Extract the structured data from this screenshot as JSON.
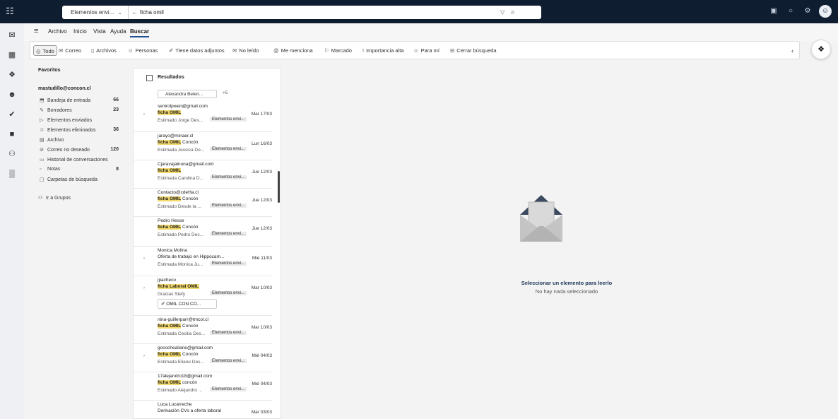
{
  "search": {
    "scope_label": "Elementos envi...",
    "query": "ficha omil"
  },
  "menu": [
    "Archivo",
    "Inicio",
    "Vista",
    "Ayuda",
    "Buscar"
  ],
  "filters": [
    {
      "label": "Todo",
      "icon": "everything-icon"
    },
    {
      "label": "Correo",
      "icon": "mail-icon"
    },
    {
      "label": "Archivos",
      "icon": "file-icon"
    },
    {
      "label": "Personas",
      "icon": "people-icon"
    },
    {
      "label": "Tiene datos adjuntos",
      "icon": "paperclip-icon"
    },
    {
      "label": "No leído",
      "icon": "unread-icon"
    },
    {
      "label": "Me menciona",
      "icon": "at-icon"
    },
    {
      "label": "Marcado",
      "icon": "flag-icon"
    },
    {
      "label": "Importancia alta",
      "icon": "exclamation-icon"
    },
    {
      "label": "Para mí",
      "icon": "person-icon"
    },
    {
      "label": "Cerrar búsqueda",
      "icon": "close-box-icon"
    }
  ],
  "folders": {
    "favorites_label": "Favoritos",
    "account": "mastudillo@concon.cl",
    "items": [
      {
        "label": "Bandeja de entrada",
        "count": "66",
        "icon": "inbox-icon"
      },
      {
        "label": "Borradores",
        "count": "23",
        "icon": "pencil-icon"
      },
      {
        "label": "Elementos enviados",
        "count": "",
        "icon": "send-icon"
      },
      {
        "label": "Elementos eliminados",
        "count": "36",
        "icon": "trash-icon"
      },
      {
        "label": "Archivo",
        "count": "",
        "icon": "archive-icon"
      },
      {
        "label": "Correo no deseado",
        "count": "120",
        "icon": "junk-icon"
      },
      {
        "label": "Historial de conversaciones",
        "count": "",
        "icon": "folder-icon"
      },
      {
        "label": "Notas",
        "count": "8",
        "icon": "note-icon"
      },
      {
        "label": "Carpetas de búsqueda",
        "count": "",
        "icon": "search-folder-icon"
      }
    ],
    "groups_label": "Ir a Grupos"
  },
  "list": {
    "title": "Resultados",
    "people_chip": "Alexandra Belen...",
    "people_more": "+5",
    "messages": [
      {
        "from": "senirolpwen@gmail.com",
        "subject_hl": "ficha OMIL",
        "subject": "",
        "date": "Mar 17/03",
        "preview": "Estimado Jorge Des...",
        "tag": "Elementos envi...",
        "attachment": ""
      },
      {
        "from": "jarayo@minaer.cl",
        "subject_hl": "ficha OMIL",
        "subject": " Concón",
        "date": "Lun 16/03",
        "preview": "Estimada Jessica Do...",
        "tag": "Elementos envi...",
        "attachment": ""
      },
      {
        "from": "Cjaravajalnuna@gmail.com",
        "subject_hl": "ficha OMIL",
        "subject": "",
        "date": "Jue 12/03",
        "preview": "Estimada Carolina D...",
        "tag": "Elementos envi...",
        "attachment": ""
      },
      {
        "from": "Contacto@cdeHa.cl",
        "subject_hl": "ficha OMIL",
        "subject": " Concón",
        "date": "Jue 12/03",
        "preview": "Estimado Desde la ...",
        "tag": "Elementos envi...",
        "attachment": ""
      },
      {
        "from": "Pedro Hesse",
        "subject_hl": "ficha OMIL",
        "subject": " Concón",
        "date": "Jue 12/03",
        "preview": "Estimado Pedro Des...",
        "tag": "Elementos envi...",
        "attachment": ""
      },
      {
        "from": "Monica Molina",
        "subject_hl": "",
        "subject": "Oferta de trabajo en Hippocam...",
        "date": "Mié 11/03",
        "preview": "Estimada Monica Ju...",
        "tag": "Elementos envi...",
        "attachment": ""
      },
      {
        "from": "jpacheco",
        "subject_hl": "ficha Laboral OMIL",
        "subject": "",
        "date": "Mar 10/03",
        "preview": "Gracias Stefy",
        "tag": "Elementos envi...",
        "attachment": "OMIL CON CO..."
      },
      {
        "from": "nina-guillerparr@tmcol.cl",
        "subject_hl": "ficha OMIL",
        "subject": " Concón",
        "date": "Mar 10/03",
        "preview": "Estimada Cecilia Des...",
        "tag": "Elementos envi...",
        "attachment": ""
      },
      {
        "from": "gocochealiane@gmail.com",
        "subject_hl": "ficha OMIL",
        "subject": " Concón",
        "date": "Mié 04/03",
        "preview": "Estimada Eliane Des...",
        "tag": "Elementos envi...",
        "attachment": ""
      },
      {
        "from": "17alejandro18@gmail.com",
        "subject_hl": "ficha OMIL",
        "subject": " concón",
        "date": "Mié 04/03",
        "preview": "Estimado Alejandro ...",
        "tag": "Elementos envi...",
        "attachment": ""
      },
      {
        "from": "Luca Lucarreche",
        "subject_hl": "",
        "subject": "Derivación CVs a oferta laboral",
        "date": "Mar 03/03",
        "preview": "",
        "tag": "",
        "attachment": ""
      }
    ]
  },
  "reading": {
    "empty_title": "Seleccionar un elemento para leerlo",
    "empty_sub": "No hay nada seleccionado"
  }
}
